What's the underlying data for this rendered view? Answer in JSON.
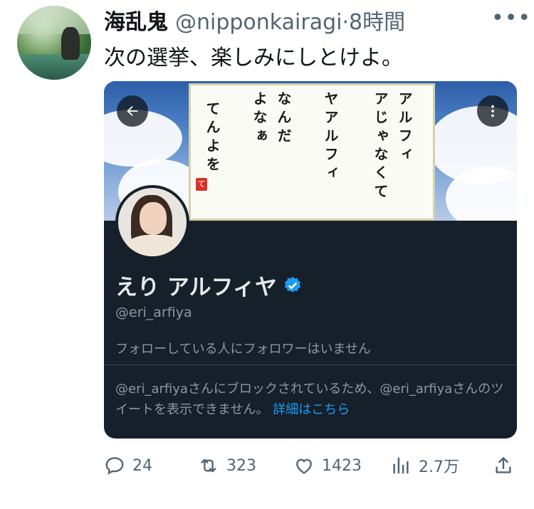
{
  "tweet": {
    "display_name": "海乱鬼",
    "handle_time": "@nipponkairagi·8時間",
    "text": "次の選挙、楽しみにしとけよ。",
    "more_glyph": "•••"
  },
  "card": {
    "calligraphy_columns": [
      "アルフィ",
      "アじゃなくて",
      "ヤアルフィ",
      "なんだ",
      "よなぁ",
      "てんよを"
    ],
    "seal_text": "て",
    "profile_name": "えり アルフィヤ",
    "profile_handle": "@eri_arfiya",
    "follow_notice": "フォローしている人にフォロワーはいません",
    "blocked_text": "@eri_arfiyaさんにブロックされているため、@eri_arfiyaさんのツイートを表示できません。",
    "blocked_link": "詳細はこちら"
  },
  "actions": {
    "reply_count": "24",
    "retweet_count": "323",
    "like_count": "1423",
    "views_count": "2.7万"
  },
  "icons": {
    "back": "arrow-left-icon",
    "menu": "vertical-dots-icon",
    "verified": "verified-badge-icon",
    "reply": "reply-icon",
    "retweet": "retweet-icon",
    "like": "heart-icon",
    "views": "analytics-icon",
    "share": "share-icon"
  },
  "colors": {
    "card_bg": "#15202b",
    "link": "#1d9bf0",
    "verified": "#1d9bf0",
    "muted": "#536471"
  }
}
